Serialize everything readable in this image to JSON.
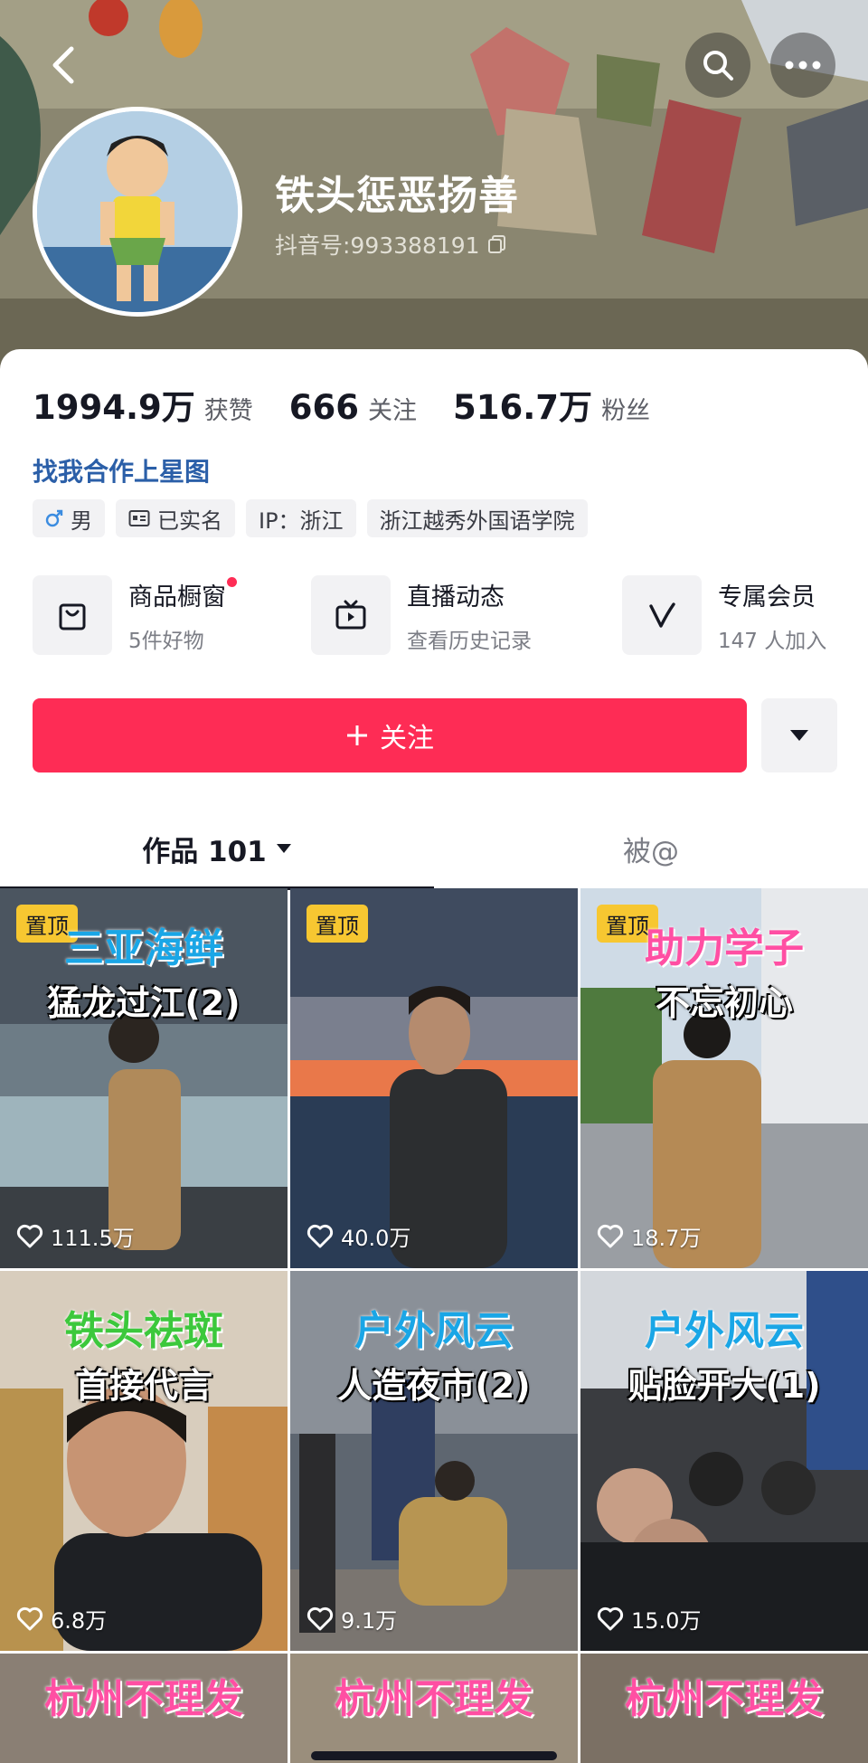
{
  "header": {
    "nickname": "铁头惩恶扬善",
    "douyin_id": "抖音号:993388191"
  },
  "stats": [
    {
      "value": "1994.9万",
      "label": "获赞"
    },
    {
      "value": "666",
      "label": "关注"
    },
    {
      "value": "516.7万",
      "label": "粉丝"
    }
  ],
  "star_link": "找我合作上星图",
  "tags": {
    "gender": "男",
    "verified": "已实名",
    "ip": "IP：浙江",
    "school": "浙江越秀外国语学院"
  },
  "shortcuts": [
    {
      "title": "商品橱窗",
      "subtitle": "5件好物",
      "icon": "shopping-bag-icon"
    },
    {
      "title": "直播动态",
      "subtitle": "查看历史记录",
      "icon": "tv-icon"
    },
    {
      "title": "专属会员",
      "subtitle": "147 人加入",
      "icon": "v-icon"
    }
  ],
  "follow_button": "关注",
  "tabs": {
    "works": "作品 101",
    "mention": "被@"
  },
  "pin_label": "置顶",
  "videos": [
    {
      "title_top": "三亚海鲜",
      "title_sub": "猛龙过江(2)",
      "likes": "111.5万",
      "pinned": true
    },
    {
      "title_top": "",
      "title_sub": "",
      "likes": "40.0万",
      "pinned": true
    },
    {
      "title_top": "助力学子",
      "title_sub": "不忘初心",
      "likes": "18.7万",
      "pinned": true
    },
    {
      "title_top": "铁头祛斑",
      "title_sub": "首接代言",
      "likes": "6.8万",
      "pinned": false
    },
    {
      "title_top": "户外风云",
      "title_sub": "人造夜市(2)",
      "likes": "9.1万",
      "pinned": false
    },
    {
      "title_top": "户外风云",
      "title_sub": "贴脸开大(1)",
      "likes": "15.0万",
      "pinned": false
    },
    {
      "title_top": "杭州不理发",
      "title_sub": "",
      "likes": "",
      "pinned": false
    },
    {
      "title_top": "杭州不理发",
      "title_sub": "",
      "likes": "",
      "pinned": false
    },
    {
      "title_top": "杭州不理发",
      "title_sub": "",
      "likes": "",
      "pinned": false
    }
  ],
  "colors": {
    "accent": "#fe2c55",
    "link": "#2b5fa8",
    "pin_badge": "#f7c731"
  }
}
